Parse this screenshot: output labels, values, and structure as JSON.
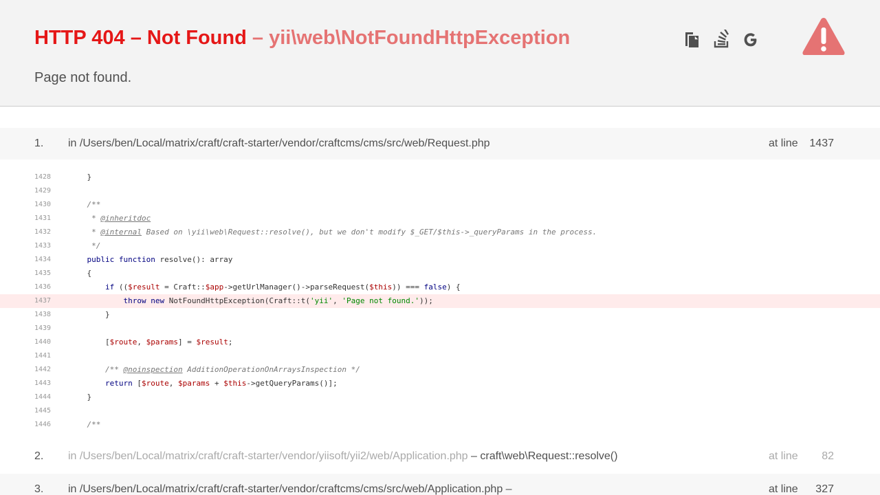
{
  "header": {
    "status_title": "HTTP 404 – Not Found",
    "exception": " – yii\\web\\NotFoundHttpException",
    "message": "Page not found.",
    "icons": [
      "copy-icon",
      "stack-overflow-icon",
      "google-icon",
      "warning-icon"
    ],
    "colors": {
      "status": "#e51717",
      "exception": "#e57373",
      "warning": "#e57373",
      "error_line": "#ffebeb"
    }
  },
  "frames": [
    {
      "number": "1.",
      "file": "in /Users/ben/Local/matrix/craft/craft-starter/vendor/craftcms/cms/src/web/Request.php",
      "call": "",
      "at_label": "at line",
      "line": "1437"
    },
    {
      "number": "2.",
      "file": "in /Users/ben/Local/matrix/craft/craft-starter/vendor/yiisoft/yii2/web/Application.php",
      "call": " – craft\\web\\Request::resolve()",
      "at_label": "at line",
      "line": "82"
    },
    {
      "number": "3.",
      "file": "in /Users/ben/Local/matrix/craft/craft-starter/vendor/craftcms/cms/src/web/Application.php",
      "call": " –",
      "at_label": "at line",
      "line": "327"
    }
  ],
  "code": {
    "error_line": "1437",
    "lines": [
      {
        "n": "1428",
        "parts": [
          {
            "t": "    }",
            "c": ""
          }
        ]
      },
      {
        "n": "1429",
        "parts": []
      },
      {
        "n": "1430",
        "parts": [
          {
            "t": "    /**",
            "c": "cm"
          }
        ]
      },
      {
        "n": "1431",
        "parts": [
          {
            "t": "     * ",
            "c": "cm"
          },
          {
            "t": "@inheritdoc",
            "c": "cm tag"
          }
        ]
      },
      {
        "n": "1432",
        "parts": [
          {
            "t": "     * ",
            "c": "cm"
          },
          {
            "t": "@internal",
            "c": "cm tag"
          },
          {
            "t": " Based on \\yii\\web\\Request::resolve(), but we don't modify $_GET/$this->_queryParams in the process.",
            "c": "cm"
          }
        ]
      },
      {
        "n": "1433",
        "parts": [
          {
            "t": "     */",
            "c": "cm"
          }
        ]
      },
      {
        "n": "1434",
        "parts": [
          {
            "t": "    ",
            "c": ""
          },
          {
            "t": "public function",
            "c": "kw"
          },
          {
            "t": " resolve(): array",
            "c": ""
          }
        ]
      },
      {
        "n": "1435",
        "parts": [
          {
            "t": "    {",
            "c": ""
          }
        ]
      },
      {
        "n": "1436",
        "parts": [
          {
            "t": "        ",
            "c": ""
          },
          {
            "t": "if",
            "c": "kw"
          },
          {
            "t": " ((",
            "c": ""
          },
          {
            "t": "$result",
            "c": "var"
          },
          {
            "t": " = Craft::",
            "c": ""
          },
          {
            "t": "$app",
            "c": "var"
          },
          {
            "t": "->getUrlManager()->parseRequest(",
            "c": ""
          },
          {
            "t": "$this",
            "c": "var"
          },
          {
            "t": ")) === ",
            "c": ""
          },
          {
            "t": "false",
            "c": "kw"
          },
          {
            "t": ") {",
            "c": ""
          }
        ]
      },
      {
        "n": "1437",
        "parts": [
          {
            "t": "            ",
            "c": ""
          },
          {
            "t": "throw new",
            "c": "kw"
          },
          {
            "t": " NotFoundHttpException(Craft::t(",
            "c": ""
          },
          {
            "t": "'yii'",
            "c": "str"
          },
          {
            "t": ", ",
            "c": ""
          },
          {
            "t": "'Page not found.'",
            "c": "str"
          },
          {
            "t": "));",
            "c": ""
          }
        ]
      },
      {
        "n": "1438",
        "parts": [
          {
            "t": "        }",
            "c": ""
          }
        ]
      },
      {
        "n": "1439",
        "parts": []
      },
      {
        "n": "1440",
        "parts": [
          {
            "t": "        [",
            "c": ""
          },
          {
            "t": "$route",
            "c": "var"
          },
          {
            "t": ", ",
            "c": ""
          },
          {
            "t": "$params",
            "c": "var"
          },
          {
            "t": "] = ",
            "c": ""
          },
          {
            "t": "$result",
            "c": "var"
          },
          {
            "t": ";",
            "c": ""
          }
        ]
      },
      {
        "n": "1441",
        "parts": []
      },
      {
        "n": "1442",
        "parts": [
          {
            "t": "        /** ",
            "c": "cm"
          },
          {
            "t": "@noinspection",
            "c": "cm tag"
          },
          {
            "t": " AdditionOperationOnArraysInspection */",
            "c": "cm"
          }
        ]
      },
      {
        "n": "1443",
        "parts": [
          {
            "t": "        ",
            "c": ""
          },
          {
            "t": "return",
            "c": "kw"
          },
          {
            "t": " [",
            "c": ""
          },
          {
            "t": "$route",
            "c": "var"
          },
          {
            "t": ", ",
            "c": ""
          },
          {
            "t": "$params",
            "c": "var"
          },
          {
            "t": " + ",
            "c": ""
          },
          {
            "t": "$this",
            "c": "var"
          },
          {
            "t": "->getQueryParams()];",
            "c": ""
          }
        ]
      },
      {
        "n": "1444",
        "parts": [
          {
            "t": "    }",
            "c": ""
          }
        ]
      },
      {
        "n": "1445",
        "parts": []
      },
      {
        "n": "1446",
        "parts": [
          {
            "t": "    /**",
            "c": "cm"
          }
        ]
      }
    ]
  }
}
